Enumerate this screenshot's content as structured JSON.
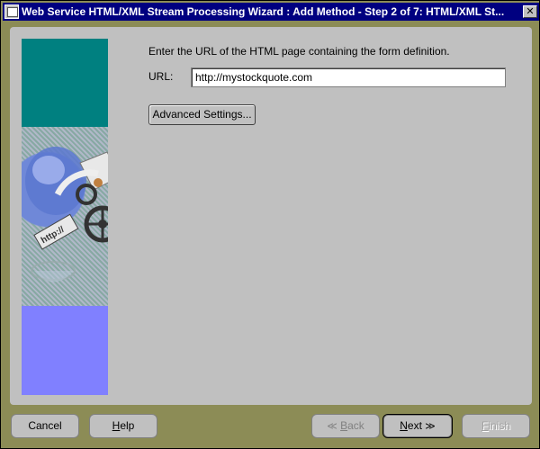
{
  "window": {
    "title": "Web Service HTML/XML Stream Processing Wizard : Add Method - Step 2 of 7: HTML/XML St...",
    "close_symbol": "✕"
  },
  "main": {
    "instruction": "Enter the URL of the HTML page containing the form definition.",
    "url_label": "URL:",
    "url_value": "http://mystockquote.com",
    "advanced_button": "Advanced Settings..."
  },
  "side_graphic": {
    "sign_text": "http://"
  },
  "footer": {
    "cancel": "Cancel",
    "help_mnemonic": "H",
    "help_rest": "elp",
    "back_mnemonic": "B",
    "back_rest": "ack",
    "back_chevron": "≪",
    "next_mnemonic": "N",
    "next_rest": "ext",
    "next_chevron": "≫",
    "finish_mnemonic": "F",
    "finish_rest": "inish"
  },
  "colors": {
    "titlebar": "#000080",
    "frame": "#8c8c56",
    "panel": "#c0c0c0",
    "side_teal": "#008080",
    "side_purple": "#8080ff"
  }
}
